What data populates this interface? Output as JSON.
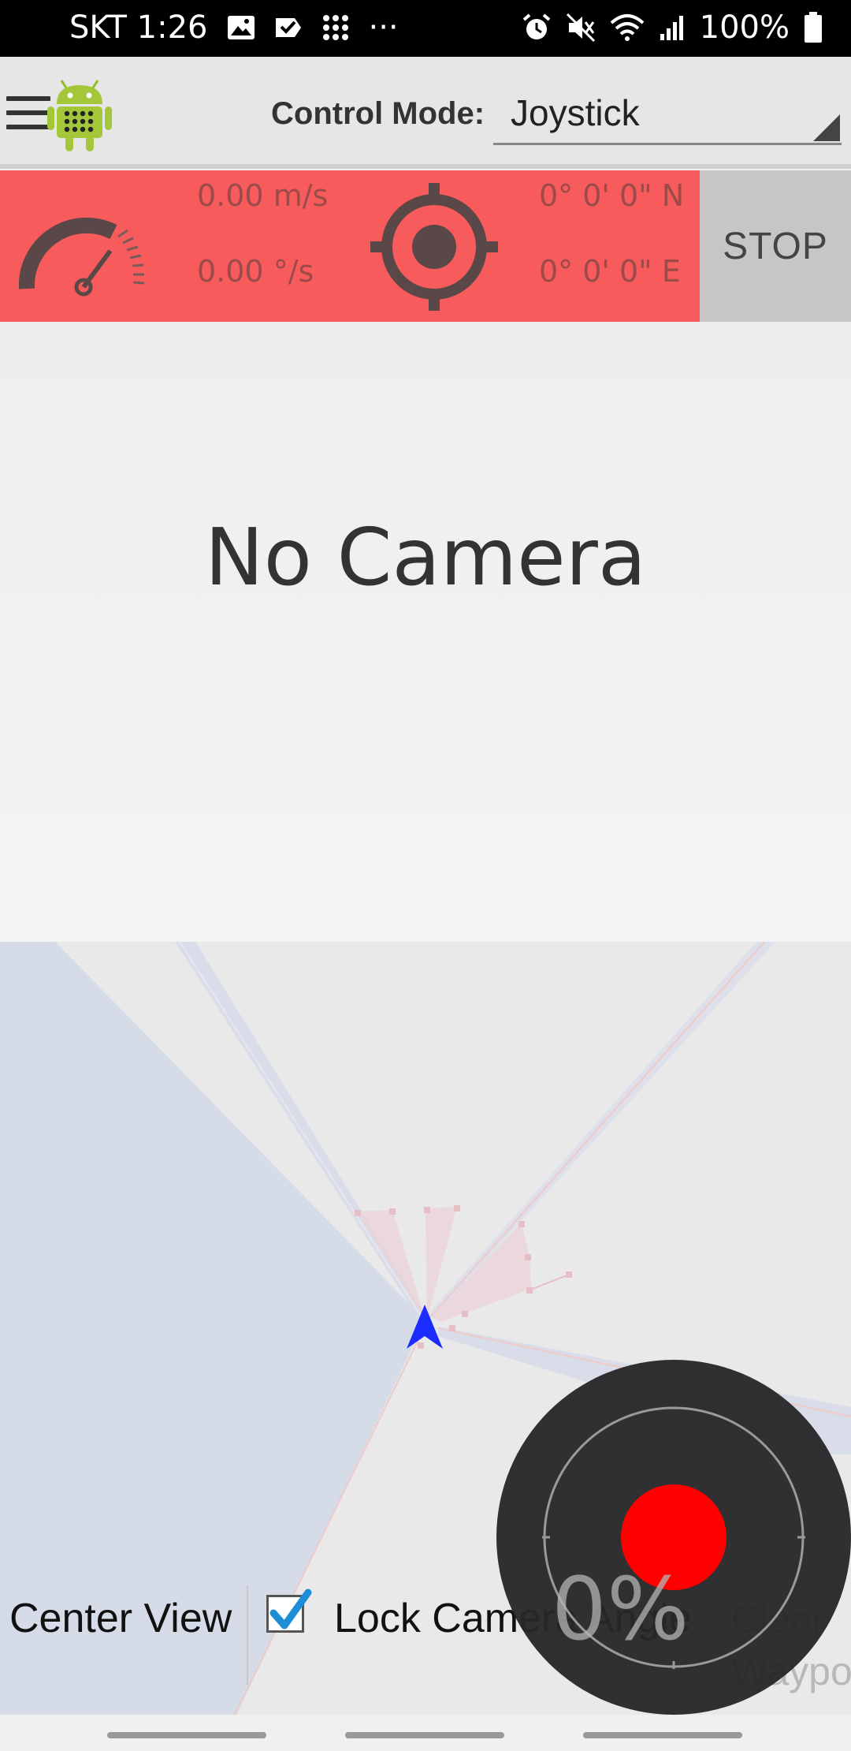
{
  "status_bar": {
    "carrier_time": "SKT 1:26",
    "overflow": "···",
    "battery": "100%",
    "icons": [
      "gallery-icon",
      "check-icon",
      "apps-icon",
      "alarm-icon",
      "mute-icon",
      "wifi-icon",
      "signal-icon",
      "battery-icon"
    ]
  },
  "action_bar": {
    "menu_icon": "hamburger-icon",
    "logo_icon": "android-icon",
    "control_mode_label": "Control Mode:",
    "control_mode_value": "Joystick"
  },
  "status_panel": {
    "color": "#f75b5b",
    "linear_speed": "0.00 m/s",
    "angular_speed": "0.00 °/s",
    "latitude": "0° 0' 0\" N",
    "longitude": "0° 0' 0\" E",
    "speed_icon": "speedometer-icon",
    "location_icon": "crosshair-icon",
    "stop_label": "STOP"
  },
  "camera": {
    "message": "No Camera"
  },
  "map": {
    "robot_icon": "navigation-arrow-icon",
    "robot_color": "#1a2cff"
  },
  "controls": {
    "center_view": "Center View",
    "lock_camera_angle": "Lock Camera Angle",
    "lock_checked": true,
    "clear_waypoints": "Clear Waypoints"
  },
  "joystick": {
    "percent": "0%",
    "knob_color": "#ff0000"
  }
}
